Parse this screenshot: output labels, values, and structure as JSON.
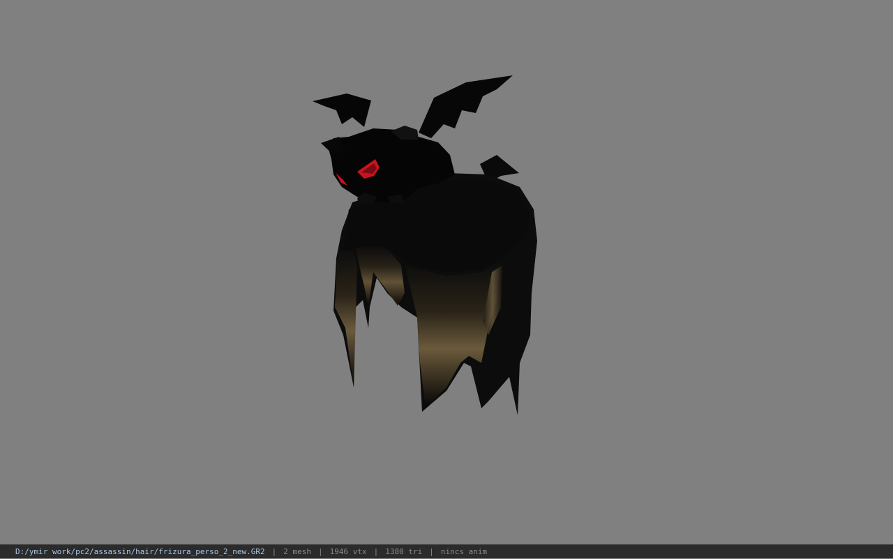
{
  "viewer": {
    "background_color": "#808080",
    "model": {
      "description_icon": "bat-hair-model-icon",
      "colors": {
        "body": "#050505",
        "shade": "#141414",
        "eye": "#c8141e",
        "hair_highlight": "#6b5a3c"
      }
    }
  },
  "statusbar": {
    "file_path": "D:/ymir work/pc2/assassin/hair/frizura_perso_2_new.GR2",
    "separator": "|",
    "mesh": "2 mesh",
    "vertices": "1946 vtx",
    "triangles": "1380 tri",
    "animation": "nincs anim"
  }
}
